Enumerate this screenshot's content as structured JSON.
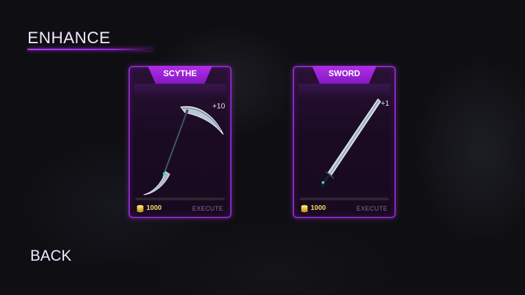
{
  "screen": {
    "title": "ENHANCE",
    "back_label": "BACK"
  },
  "cards": [
    {
      "name": "SCYTHE",
      "level": "+10",
      "cost": "1000",
      "action": "EXECUTE"
    },
    {
      "name": "SWORD",
      "level": "+1",
      "cost": "1000",
      "action": "EXECUTE"
    }
  ],
  "colors": {
    "accent": "#a025e0",
    "card_border": "#8a2bc0",
    "coin": "#f5d76b",
    "action": "#8e6aa6"
  }
}
